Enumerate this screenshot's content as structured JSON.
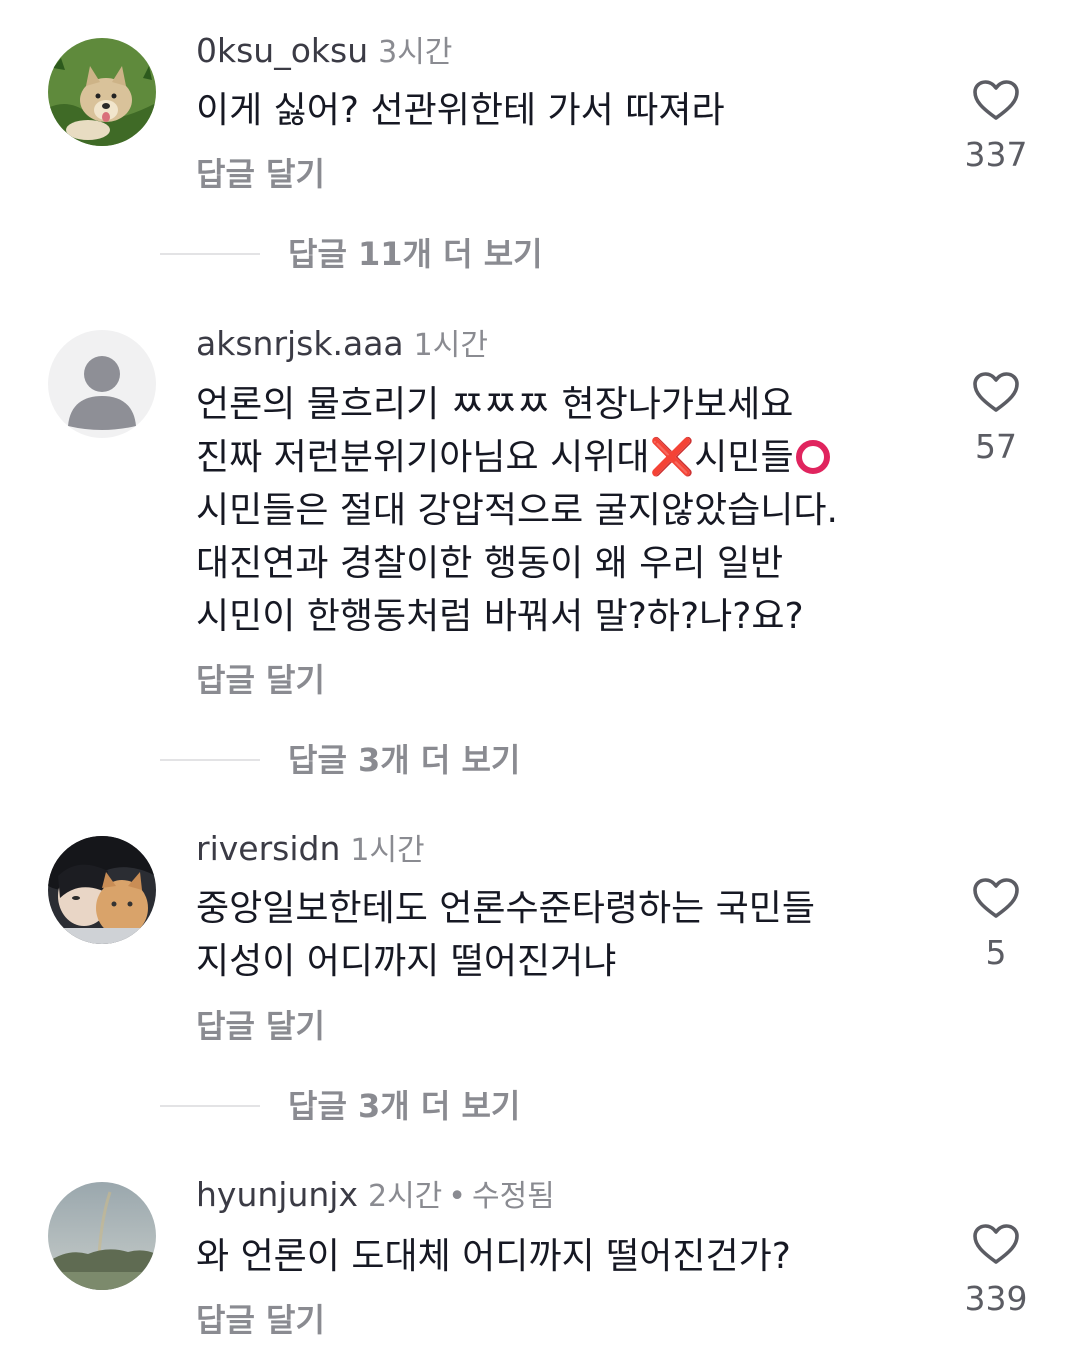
{
  "comments": [
    {
      "username": "0ksu_oksu",
      "time": "3시간",
      "text": "이게 싫어? 선관위한테 가서 따져라",
      "reply_label": "답글 달기",
      "likes": "337",
      "more_replies": "답글 11개 더 보기",
      "avatar_icon": "dog-photo"
    },
    {
      "username": "aksnrjsk.aaa",
      "time": "1시간",
      "text_lines": [
        "언론의 물흐리기 ㅉㅉㅉ 현장나가보세요",
        "진짜 저런분위기아님요 시위대",
        "시민들",
        "시민들은 절대 강압적으로 굴지않았습니다.",
        "대진연과 경찰이한 행동이 왜 우리 일반",
        "시민이 한행동처럼 바꿔서 말?하?나?요?"
      ],
      "reply_label": "답글 달기",
      "likes": "57",
      "more_replies": "답글 3개 더 보기",
      "avatar_icon": "default-user-icon",
      "emoji_x": "❌"
    },
    {
      "username": "riversidn",
      "time": "1시간",
      "text": "중앙일보한테도 언론수준타령하는 국민들\n지성이 어디까지 떨어진거냐",
      "reply_label": "답글 달기",
      "likes": "5",
      "more_replies": "답글 3개 더 보기",
      "avatar_icon": "person-with-cat-photo"
    },
    {
      "username": "hyunjunjx",
      "time": "2시간",
      "edited": "수정됨",
      "dot": "•",
      "text": "와 언론이 도대체 어디까지 떨어진건가?",
      "reply_label": "답글 달기",
      "likes": "339",
      "avatar_icon": "landscape-photo"
    }
  ],
  "colors": {
    "text": "#161823",
    "muted": "#8a8b91",
    "emoji_red": "#e0245e"
  }
}
